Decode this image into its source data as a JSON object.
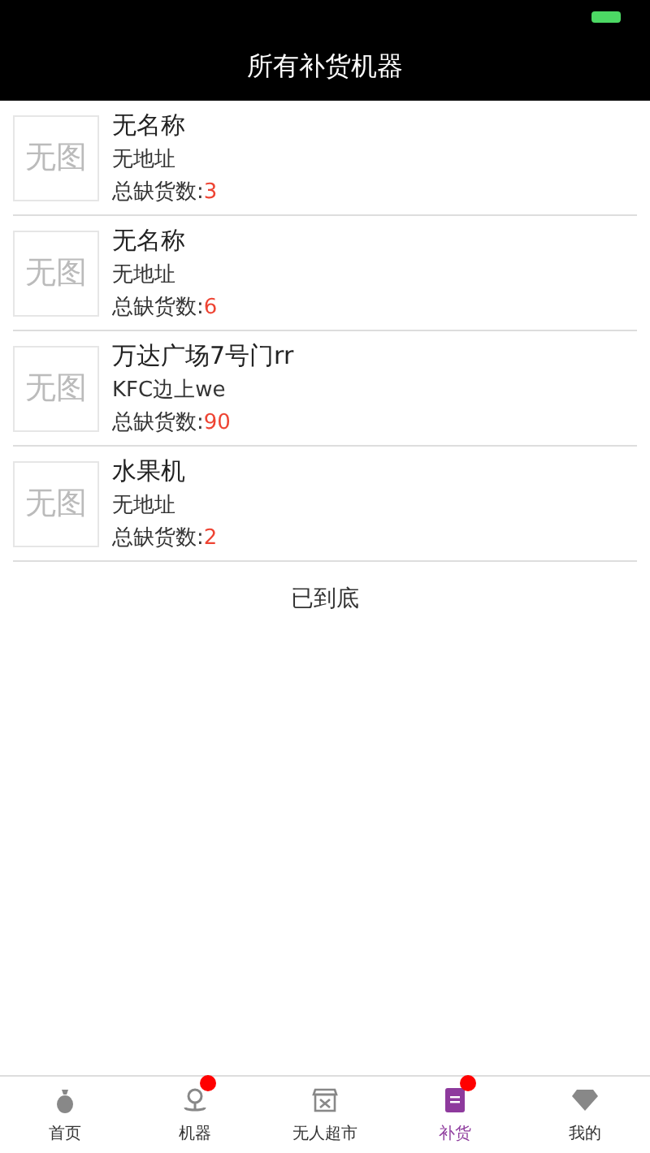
{
  "header": {
    "title": "所有补货机器"
  },
  "machines": [
    {
      "thumb": "无图",
      "name": "无名称",
      "address": "无地址",
      "shortage_label": "总缺货数:",
      "shortage": "3"
    },
    {
      "thumb": "无图",
      "name": "无名称",
      "address": "无地址",
      "shortage_label": "总缺货数:",
      "shortage": "6"
    },
    {
      "thumb": "无图",
      "name": "万达广场7号门rr",
      "address": "KFC边上we",
      "shortage_label": "总缺货数:",
      "shortage": "90"
    },
    {
      "thumb": "无图",
      "name": "水果机",
      "address": "无地址",
      "shortage_label": "总缺货数:",
      "shortage": "2"
    }
  ],
  "end_text": "已到底",
  "tabs": [
    {
      "label": "首页",
      "selected": false,
      "badge": false
    },
    {
      "label": "机器",
      "selected": false,
      "badge": true
    },
    {
      "label": "无人超市",
      "selected": false,
      "badge": false
    },
    {
      "label": "补货",
      "selected": true,
      "badge": true
    },
    {
      "label": "我的",
      "selected": false,
      "badge": false
    }
  ]
}
